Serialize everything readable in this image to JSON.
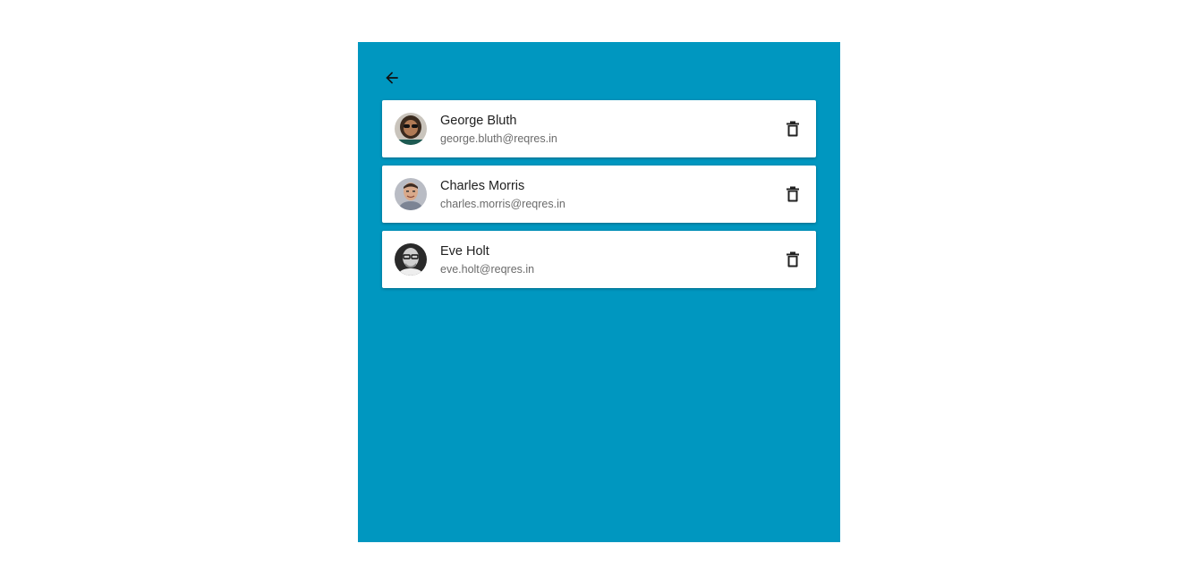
{
  "app": {
    "accent_color": "#0097c0",
    "back_icon": "arrow-left-icon",
    "delete_icon": "trash-icon"
  },
  "users": [
    {
      "name": "George Bluth",
      "email": "george.bluth@reqres.in",
      "avatar": "avatar-george"
    },
    {
      "name": "Charles Morris",
      "email": "charles.morris@reqres.in",
      "avatar": "avatar-charles"
    },
    {
      "name": "Eve Holt",
      "email": "eve.holt@reqres.in",
      "avatar": "avatar-eve"
    }
  ]
}
